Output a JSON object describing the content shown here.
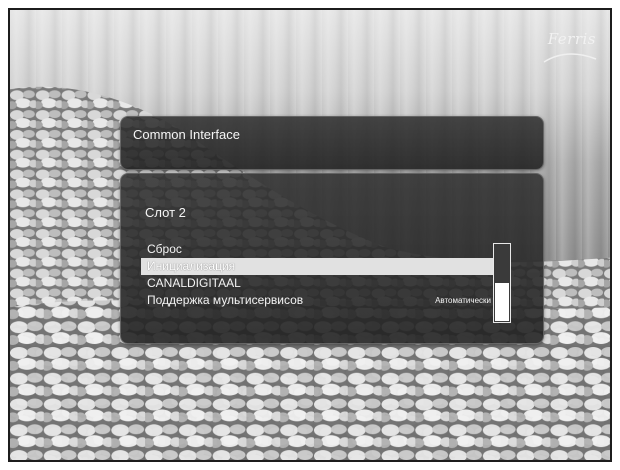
{
  "brand": {
    "logo_text": "Ferris"
  },
  "header": {
    "title": "Common Interface"
  },
  "slot": {
    "title": "Слот 2"
  },
  "menu": {
    "items": [
      {
        "label": "Сброс",
        "value": ""
      },
      {
        "label": "Инициализация",
        "value": ""
      },
      {
        "label": "CANALDIGITAAL",
        "value": ""
      },
      {
        "label": "Поддержка мультисервисов",
        "value": "Автоматически"
      }
    ],
    "selected_index": 1
  },
  "scrollbar": {
    "fill_fraction": 0.5
  },
  "colors": {
    "panel": "#2c2c2c",
    "highlight": "#e1e1e1",
    "text": "#f3f3f3"
  }
}
